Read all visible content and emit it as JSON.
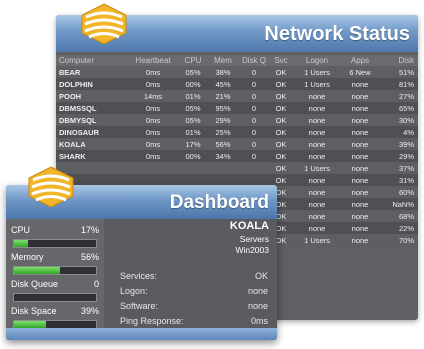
{
  "network": {
    "title": "Network Status",
    "columns": [
      "Computer",
      "Heartbeat",
      "CPU",
      "Mem",
      "Disk Q",
      "Svc",
      "Logon",
      "Apps",
      "Disk"
    ],
    "rows": [
      [
        "BEAR",
        "0ms",
        "05%",
        "38%",
        "0",
        "OK",
        "1 Users",
        "6 New",
        "51%"
      ],
      [
        "DOLPHIN",
        "0ms",
        "00%",
        "45%",
        "0",
        "OK",
        "1 Users",
        "none",
        "81%"
      ],
      [
        "POOH",
        "14ms",
        "01%",
        "21%",
        "0",
        "OK",
        "none",
        "none",
        "27%"
      ],
      [
        "DBMSSQL",
        "0ms",
        "05%",
        "95%",
        "0",
        "OK",
        "none",
        "none",
        "65%"
      ],
      [
        "DBMYSQL",
        "0ms",
        "05%",
        "29%",
        "0",
        "OK",
        "none",
        "none",
        "30%"
      ],
      [
        "DINOSAUR",
        "0ms",
        "01%",
        "25%",
        "0",
        "OK",
        "none",
        "none",
        "4%"
      ],
      [
        "KOALA",
        "0ms",
        "17%",
        "56%",
        "0",
        "OK",
        "none",
        "none",
        "39%"
      ],
      [
        "SHARK",
        "0ms",
        "00%",
        "34%",
        "0",
        "OK",
        "none",
        "none",
        "29%"
      ],
      [
        "",
        "",
        "",
        "",
        "",
        "OK",
        "1 Users",
        "none",
        "37%"
      ],
      [
        "",
        "",
        "",
        "",
        "",
        "OK",
        "none",
        "none",
        "31%"
      ],
      [
        "",
        "",
        "",
        "",
        "",
        "OK",
        "none",
        "none",
        "60%"
      ],
      [
        "",
        "",
        "",
        "",
        "",
        "OK",
        "none",
        "none",
        "NaN%"
      ],
      [
        "",
        "",
        "",
        "",
        "",
        "OK",
        "none",
        "none",
        "68%"
      ],
      [
        "",
        "",
        "",
        "",
        "",
        "OK",
        "none",
        "none",
        "22%"
      ],
      [
        "",
        "",
        "",
        "",
        "",
        "OK",
        "1 Users",
        "none",
        "70%"
      ]
    ]
  },
  "dashboard": {
    "title": "Dashboard",
    "metrics": [
      {
        "label": "CPU",
        "value": "17%",
        "fill": 0.17
      },
      {
        "label": "Memory",
        "value": "56%",
        "fill": 0.56
      },
      {
        "label": "Disk Queue",
        "value": "0",
        "fill": 0.0
      },
      {
        "label": "Disk Space",
        "value": "39%",
        "fill": 0.39
      }
    ],
    "host": {
      "name": "KOALA",
      "role": "Servers",
      "os": "Win2003"
    },
    "info": [
      {
        "key": "Services:",
        "value": "OK"
      },
      {
        "key": "Logon:",
        "value": "none"
      },
      {
        "key": "Software:",
        "value": "none"
      },
      {
        "key": "Ping Response:",
        "value": "0ms"
      }
    ]
  },
  "colors": {
    "header_blue": "#6f98c7",
    "bar_green": "#2fa52a",
    "logo_gold": "#e8a417"
  },
  "icons": {
    "network_logo": "layered-stripes-logo-icon",
    "dashboard_logo": "layered-stripes-logo-icon"
  }
}
